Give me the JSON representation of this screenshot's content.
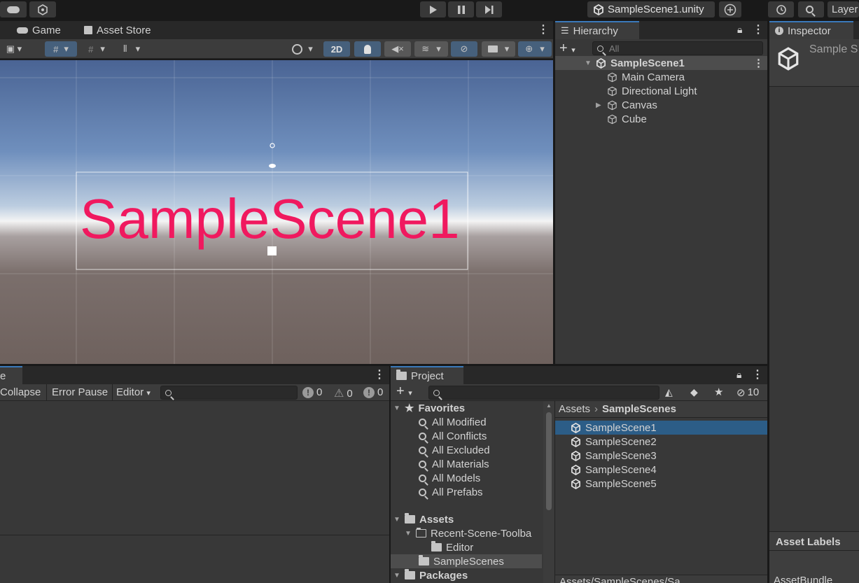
{
  "scene_tab": {
    "label": "SampleScene1.unity"
  },
  "top_right": {
    "layers_label": "Layer"
  },
  "scene_view": {
    "tabs": [
      {
        "label": "Game"
      },
      {
        "label": "Asset Store"
      }
    ],
    "btn_2d": "2D",
    "text_object": "SampleScene1",
    "text_color": "#f0195f"
  },
  "hierarchy": {
    "tab_label": "Hierarchy",
    "search_placeholder": "All",
    "root": "SampleScene1",
    "items": [
      {
        "label": "Main Camera"
      },
      {
        "label": "Directional Light"
      },
      {
        "label": "Canvas"
      },
      {
        "label": "Cube"
      }
    ]
  },
  "inspector": {
    "tab_label": "Inspector",
    "title": "Sample S",
    "asset_labels": "Asset Labels",
    "asset_bundle": "AssetBundle"
  },
  "console": {
    "tab_label": "e",
    "collapse": "Collapse",
    "error_pause": "Error Pause",
    "editor": "Editor",
    "count_info": "0",
    "count_warn": "0",
    "count_error": "0"
  },
  "project": {
    "tab_label": "Project",
    "hidden_count": "10",
    "favorites_label": "Favorites",
    "favorites": [
      {
        "label": "All Modified"
      },
      {
        "label": "All Conflicts"
      },
      {
        "label": "All Excluded"
      },
      {
        "label": "All Materials"
      },
      {
        "label": "All Models"
      },
      {
        "label": "All Prefabs"
      }
    ],
    "assets_label": "Assets",
    "assets_children": [
      {
        "label": "Recent-Scene-Toolba"
      },
      {
        "label": "Editor"
      },
      {
        "label": "SampleScenes"
      }
    ],
    "packages_label": "Packages",
    "breadcrumb_root": "Assets",
    "breadcrumb_current": "SampleScenes",
    "files": [
      {
        "label": "SampleScene1"
      },
      {
        "label": "SampleScene2"
      },
      {
        "label": "SampleScene3"
      },
      {
        "label": "SampleScene4"
      },
      {
        "label": "SampleScene5"
      }
    ],
    "footer_path": "Assets/SampleScenes/Sa"
  }
}
